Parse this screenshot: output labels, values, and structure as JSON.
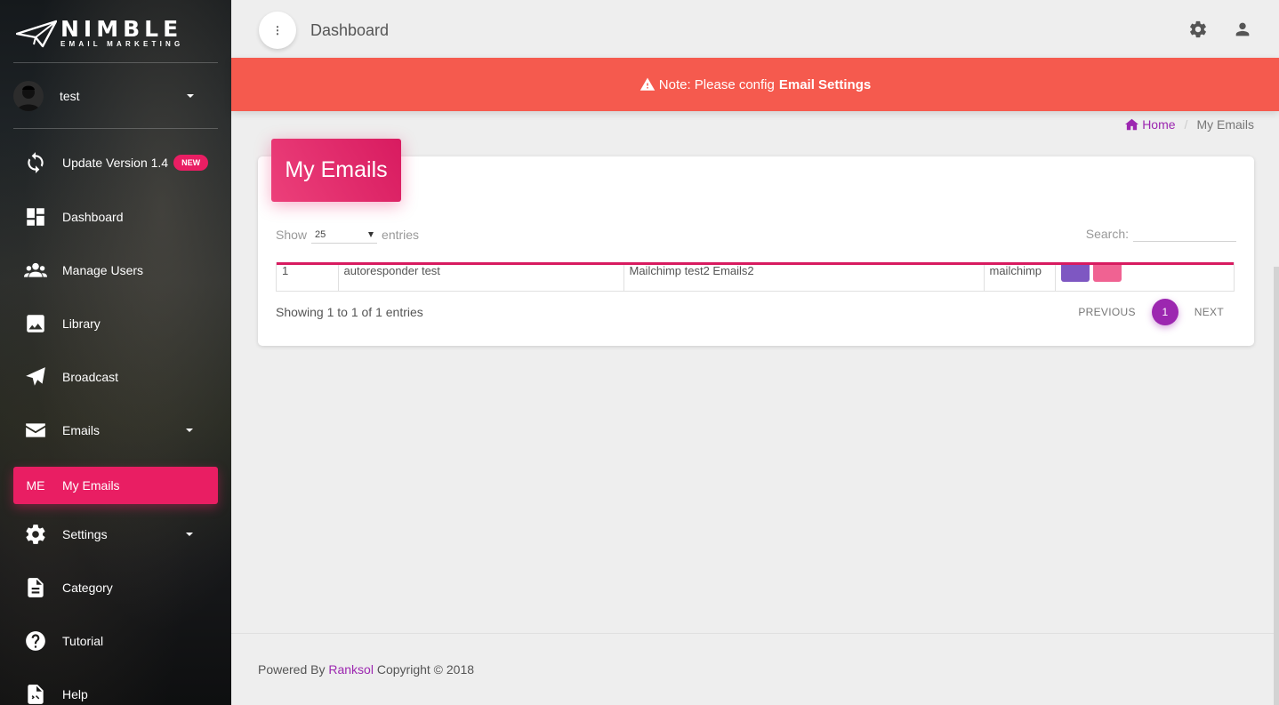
{
  "brand": {
    "name": "NIMBLE",
    "tagline": "EMAIL MARKETING"
  },
  "user": {
    "name": "test"
  },
  "sidebar": {
    "items": [
      {
        "label": "Update Version 1.4",
        "badge": "NEW",
        "icon": "refresh-icon"
      },
      {
        "label": "Dashboard",
        "icon": "dashboard-icon"
      },
      {
        "label": "Manage Users",
        "icon": "users-icon"
      },
      {
        "label": "Library",
        "icon": "image-icon"
      },
      {
        "label": "Broadcast",
        "icon": "paper-plane-icon"
      },
      {
        "label": "Emails",
        "icon": "envelope-icon"
      },
      {
        "label": "My Emails",
        "abbr": "ME",
        "active": true
      },
      {
        "label": "Settings",
        "icon": "gear-icon"
      },
      {
        "label": "Category",
        "icon": "document-icon"
      },
      {
        "label": "Tutorial",
        "icon": "help-circle-icon"
      },
      {
        "label": "Help",
        "icon": "help-doc-icon"
      }
    ]
  },
  "topbar": {
    "title": "Dashboard",
    "menu_glyph": "⋮"
  },
  "alert": {
    "prefix": "Note: Please config",
    "link": "Email Settings"
  },
  "breadcrumb": {
    "home": "Home",
    "current": "My Emails"
  },
  "card": {
    "title": "My Emails",
    "show_label": "Show",
    "entries_label": "entries",
    "length_value": "25",
    "search_label": "Search:",
    "search_value": "",
    "table": {
      "rows": [
        [
          "1",
          "autoresponder test",
          "Mailchimp test2 Emails2",
          "mailchimp"
        ]
      ]
    },
    "info": "Showing 1 to 1 of 1 entries",
    "pagination": {
      "previous": "PREVIOUS",
      "current": "1",
      "next": "NEXT"
    }
  },
  "footer": {
    "prefix": "Powered By",
    "link": "Ranksol",
    "suffix": "Copyright © 2018"
  },
  "colors": {
    "accent": "#e91e63",
    "alert": "#f55a4e",
    "purple": "#9c27b0"
  }
}
